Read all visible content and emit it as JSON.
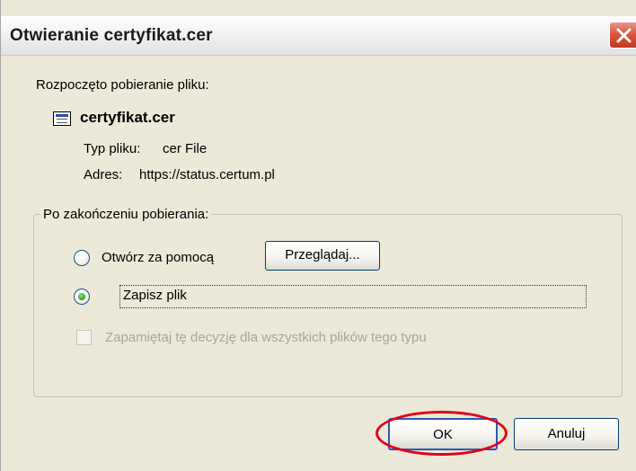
{
  "dialog": {
    "title": "Otwieranie certyfikat.cer",
    "intro": "Rozpoczęto pobieranie pliku:",
    "file": {
      "icon": "certificate-file-icon",
      "name": "certyfikat.cer",
      "type_label": "Typ pliku:",
      "type_value": "cer File",
      "address_label": "Adres:",
      "address_value": "https://status.certum.pl"
    },
    "after_download": {
      "group_label": "Po zakończeniu pobierania:",
      "open_with_label": "Otwórz za pomocą",
      "browse_label": "Przeglądaj...",
      "save_file_label": "Zapisz plik",
      "selected": "save_file",
      "remember_label": "Zapamiętaj tę decyzję dla wszystkich plików tego typu",
      "remember_checked": false
    },
    "buttons": {
      "ok_label": "OK",
      "cancel_label": "Anuluj"
    }
  },
  "colors": {
    "dialog_bg": "#ece9d8",
    "close_button": "#d8533a",
    "radio_selected": "#2ea11c",
    "highlight_oval": "#e0001a",
    "disabled_text": "#a7a597"
  }
}
